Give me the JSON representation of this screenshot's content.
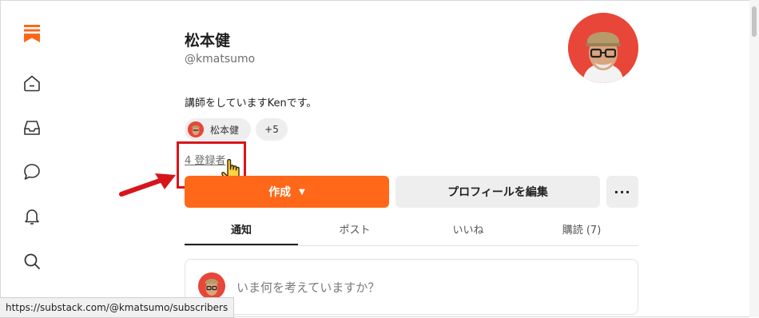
{
  "sidebar": {
    "items": [
      {
        "icon": "home-icon"
      },
      {
        "icon": "inbox-icon"
      },
      {
        "icon": "chat-icon"
      },
      {
        "icon": "bell-icon"
      },
      {
        "icon": "search-icon"
      }
    ],
    "logo_icon": "substack-logo-icon"
  },
  "profile": {
    "name": "松本健",
    "handle": "@kmatsumo",
    "bio": "講師をしていますKenです。",
    "chip_name": "松本健",
    "chip_more": "+5",
    "subscribers_link": "4 登録者"
  },
  "actions": {
    "create_label": "作成",
    "create_caret": "▼",
    "edit_label": "プロフィールを編集",
    "more_label": "···"
  },
  "tabs": [
    {
      "label": "通知",
      "active": true
    },
    {
      "label": "ポスト",
      "active": false
    },
    {
      "label": "いいね",
      "active": false
    },
    {
      "label": "購読 (7)",
      "active": false
    }
  ],
  "composer": {
    "placeholder": "いま何を考えていますか？"
  },
  "status_bar": {
    "url": "https://substack.com/@kmatsumo/subscribers"
  },
  "colors": {
    "brand": "#ff6719",
    "annotation_red": "#d8151b",
    "avatar_bg": "#e84638"
  }
}
